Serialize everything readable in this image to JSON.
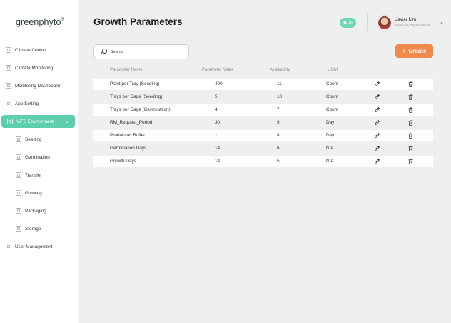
{
  "app": {
    "logo": "greenphyto",
    "logo_mark": "®"
  },
  "sidebar": {
    "items": [
      {
        "label": "Climate Control",
        "name": "sidebar-item-climate-control"
      },
      {
        "label": "Climate Monitoring",
        "name": "sidebar-item-climate-monitoring"
      },
      {
        "label": "Monitoring Dashboard",
        "name": "sidebar-item-monitoring-dashboard"
      },
      {
        "label": "App Setting",
        "name": "sidebar-item-app-setting"
      },
      {
        "label": "VIFS Environment",
        "name": "sidebar-item-vifs-environment",
        "active": true
      },
      {
        "label": "Seeding",
        "name": "sidebar-item-seeding",
        "sub": true
      },
      {
        "label": "Germination",
        "name": "sidebar-item-germination",
        "sub": true
      },
      {
        "label": "Transfer",
        "name": "sidebar-item-transfer",
        "sub": true
      },
      {
        "label": "Growing",
        "name": "sidebar-item-growing",
        "sub": true
      },
      {
        "label": "Packaging",
        "name": "sidebar-item-packaging",
        "sub": true
      },
      {
        "label": "Storage",
        "name": "sidebar-item-storage",
        "sub": true
      },
      {
        "label": "User Management",
        "name": "sidebar-item-user-management"
      }
    ]
  },
  "header": {
    "title": "Growth Parameters",
    "notification_count": "16",
    "user_name": "Javier Lim",
    "user_farm": "Quan Fa Organic Farm"
  },
  "toolbar": {
    "search_placeholder": "Search",
    "create_label": "Create"
  },
  "table": {
    "columns": [
      "Parameter Name",
      "Parameter Value",
      "Availability",
      "UOM"
    ],
    "rows": [
      [
        "Plant per Tray (Seeding)",
        "400",
        "11",
        "Count"
      ],
      [
        "Trays per Cage (Seeding)",
        "5",
        "10",
        "Count"
      ],
      [
        "Trays per Cage (Germination)",
        "4",
        "7",
        "Count"
      ],
      [
        "RM_Request_Period",
        "30",
        "9",
        "Day"
      ],
      [
        "Production Buffer",
        "1",
        "8",
        "Day"
      ],
      [
        "Germination Days",
        "14",
        "6",
        "N/A"
      ],
      [
        "Growth Days",
        "14",
        "5",
        "N/A"
      ]
    ]
  },
  "colors": {
    "accent": "#5ecfae",
    "create": "#f08a4b",
    "background": "#eef0ef"
  }
}
